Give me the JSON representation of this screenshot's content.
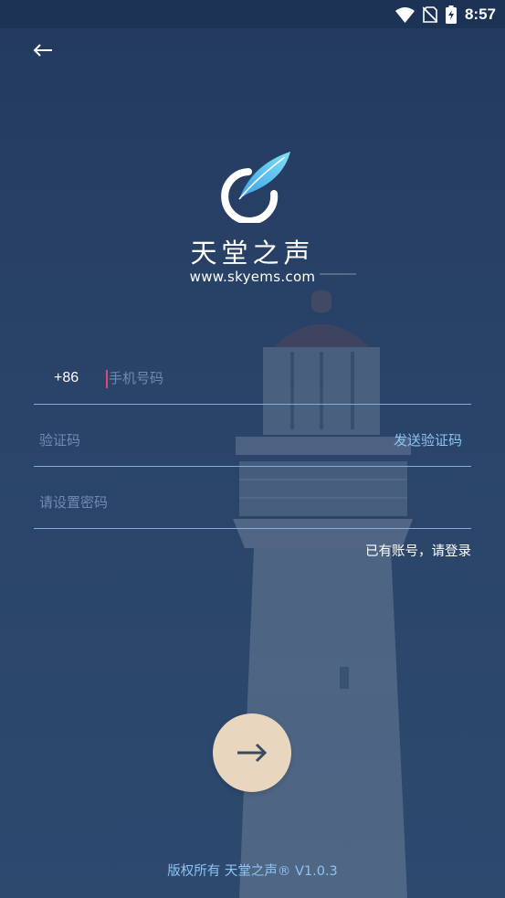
{
  "status_bar": {
    "time": "8:57",
    "icons": [
      "wifi-icon",
      "no-sim-icon",
      "battery-charging-icon"
    ]
  },
  "nav": {
    "back_icon": "arrow-left-icon"
  },
  "brand": {
    "logo": "feather-circle-logo",
    "name": "天堂之声",
    "url": "www.skyems.com"
  },
  "form": {
    "country_code": "+86",
    "phone": {
      "value": "",
      "placeholder": "手机号码"
    },
    "code": {
      "value": "",
      "placeholder": "验证码"
    },
    "send_code_label": "发送验证码",
    "password": {
      "value": "",
      "placeholder": "请设置密码"
    },
    "login_link": "已有账号，请登录",
    "submit_icon": "arrow-right-icon"
  },
  "footer": {
    "copyright": "版权所有 天堂之声® V1.0.3"
  },
  "colors": {
    "background": "#2a4469",
    "status_bar": "#1d3355",
    "accent": "#8ec3f3",
    "field_underline": "#7faee0",
    "button": "#e8d7be",
    "caret": "#e0457b"
  }
}
